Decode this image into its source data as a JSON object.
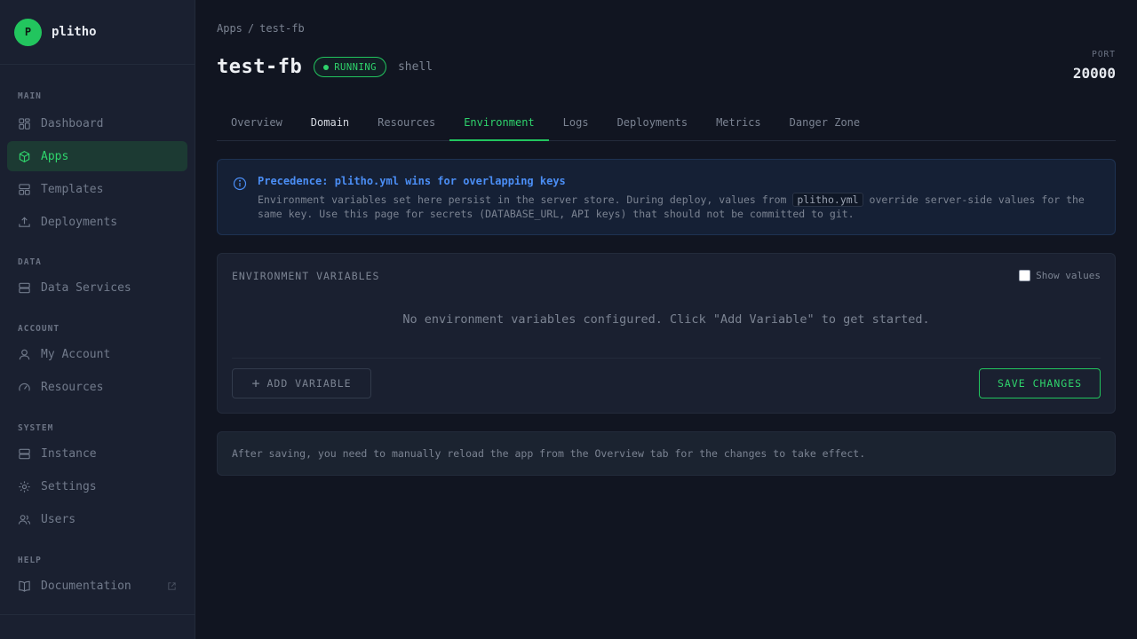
{
  "brand": {
    "logo_letter": "P",
    "name": "plitho"
  },
  "sidebar": {
    "sections": {
      "main": {
        "heading": "MAIN",
        "items": [
          {
            "label": "Dashboard",
            "icon": "grid-icon"
          },
          {
            "label": "Apps",
            "icon": "cube-icon",
            "active": true
          },
          {
            "label": "Templates",
            "icon": "template-icon"
          },
          {
            "label": "Deployments",
            "icon": "upload-icon"
          }
        ]
      },
      "data": {
        "heading": "DATA",
        "items": [
          {
            "label": "Data Services",
            "icon": "database-icon"
          }
        ]
      },
      "account": {
        "heading": "ACCOUNT",
        "items": [
          {
            "label": "My Account",
            "icon": "user-icon"
          },
          {
            "label": "Resources",
            "icon": "gauge-icon"
          }
        ]
      },
      "system": {
        "heading": "SYSTEM",
        "items": [
          {
            "label": "Instance",
            "icon": "server-icon"
          },
          {
            "label": "Settings",
            "icon": "gear-icon"
          },
          {
            "label": "Users",
            "icon": "users-icon"
          }
        ]
      },
      "help": {
        "heading": "HELP",
        "items": [
          {
            "label": "Documentation",
            "icon": "book-icon",
            "external": true
          }
        ]
      }
    }
  },
  "breadcrumb": {
    "root": "Apps",
    "separator": "/",
    "current": "test-fb"
  },
  "app": {
    "name": "test-fb",
    "status": "RUNNING",
    "type": "shell"
  },
  "port": {
    "label": "PORT",
    "value": "20000"
  },
  "tabs": [
    "Overview",
    "Domain",
    "Resources",
    "Environment",
    "Logs",
    "Deployments",
    "Metrics",
    "Danger Zone"
  ],
  "active_tab": "Environment",
  "info": {
    "title": "Precedence: plitho.yml wins for overlapping keys",
    "body_pre": "Environment variables set here persist in the server store. During deploy, values from ",
    "body_code": "plitho.yml",
    "body_post": " override server-side values for the same key. Use this page for secrets (DATABASE_URL, API keys) that should not be committed to git."
  },
  "env": {
    "title": "ENVIRONMENT VARIABLES",
    "show_values_label": "Show values",
    "show_values_checked": false,
    "empty_message": "No environment variables configured. Click \"Add Variable\" to get started.",
    "add_button": "ADD VARIABLE",
    "save_button": "SAVE CHANGES"
  },
  "note": "After saving, you need to manually reload the app from the Overview tab for the changes to take effect.",
  "colors": {
    "accent": "#22c55e",
    "info": "#4b8ef5",
    "background": "#111521",
    "sidebar": "#1a2030"
  }
}
